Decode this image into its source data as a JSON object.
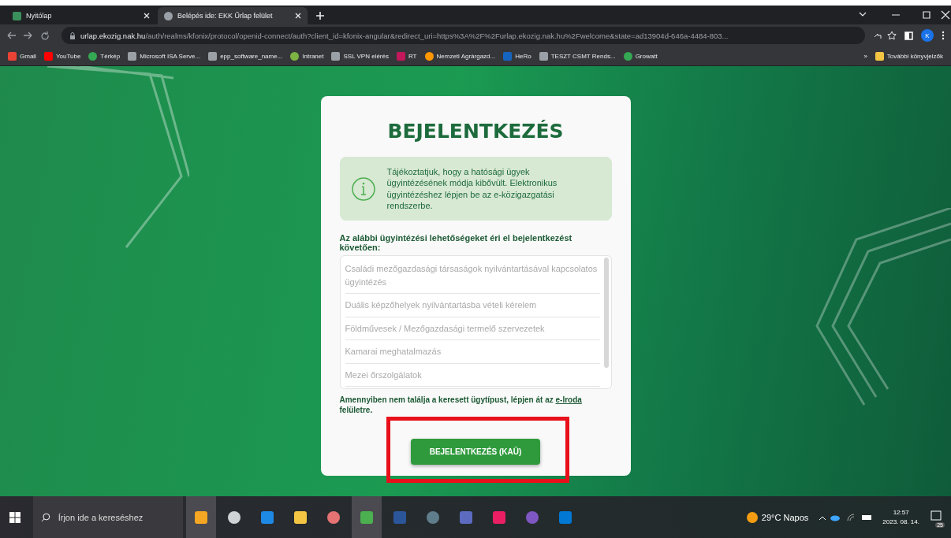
{
  "tabs": [
    {
      "label": "Nyitólap",
      "selected": false
    },
    {
      "label": "Belépés ide: EKK Űrlap felület",
      "selected": true
    }
  ],
  "address": {
    "host": "urlap.ekozig.nak.hu",
    "path": "/auth/realms/kfonix/protocol/openid-connect/auth?client_id=kfonix-angular&redirect_uri=https%3A%2F%2Furlap.ekozig.nak.hu%2Fwelcome&state=ad13904d-646a-4484-803..."
  },
  "profile": "K",
  "bookmarks": [
    "Gmail",
    "YouTube",
    "Térkép",
    "Microsoft ISA Serve...",
    "epp_software_name...",
    "Intranet",
    "SSL VPN elérés",
    "RT",
    "Nemzeti Agrárgazd...",
    "HeRo",
    "TESZT CSMT Rends...",
    "Growatt"
  ],
  "bookmarks_more": "»",
  "other_bookmarks": "További könyvjelzők",
  "login": {
    "title": "BEJELENTKEZÉS",
    "info": "Tájékoztatjuk, hogy a hatósági ügyek ügyintézésének módja kibővült. Elektronikus ügyintézéshez lépjen be az e-közigazgatási rendszerbe.",
    "list_label": "Az alábbi ügyintézési lehetőségeket éri el bejelentkezést követően:",
    "services": [
      "Családi mezőgazdasági társaságok nyilvántartásával kapcsolatos ügyintézés",
      "Duális képzőhelyek nyilvántartásba vételi kérelem",
      "Földművesek / Mezőgazdasági termelő szervezetek",
      "Kamarai meghatalmazás",
      "Mezei őrszolgálatok"
    ],
    "footer_before": "Amennyiben nem találja a keresett ügytípust, lépjen át az",
    "footer_link": "e-Iroda",
    "footer_after": "felületre.",
    "button": "BEJELENTKEZÉS (KAÜ)",
    "highlighted": true
  },
  "taskbar": {
    "search_placeholder": "Írjon ide a kereséshez",
    "weather": "29°C Napos",
    "time": "12:57",
    "date": "2023. 08. 14.",
    "notifications": "25"
  }
}
